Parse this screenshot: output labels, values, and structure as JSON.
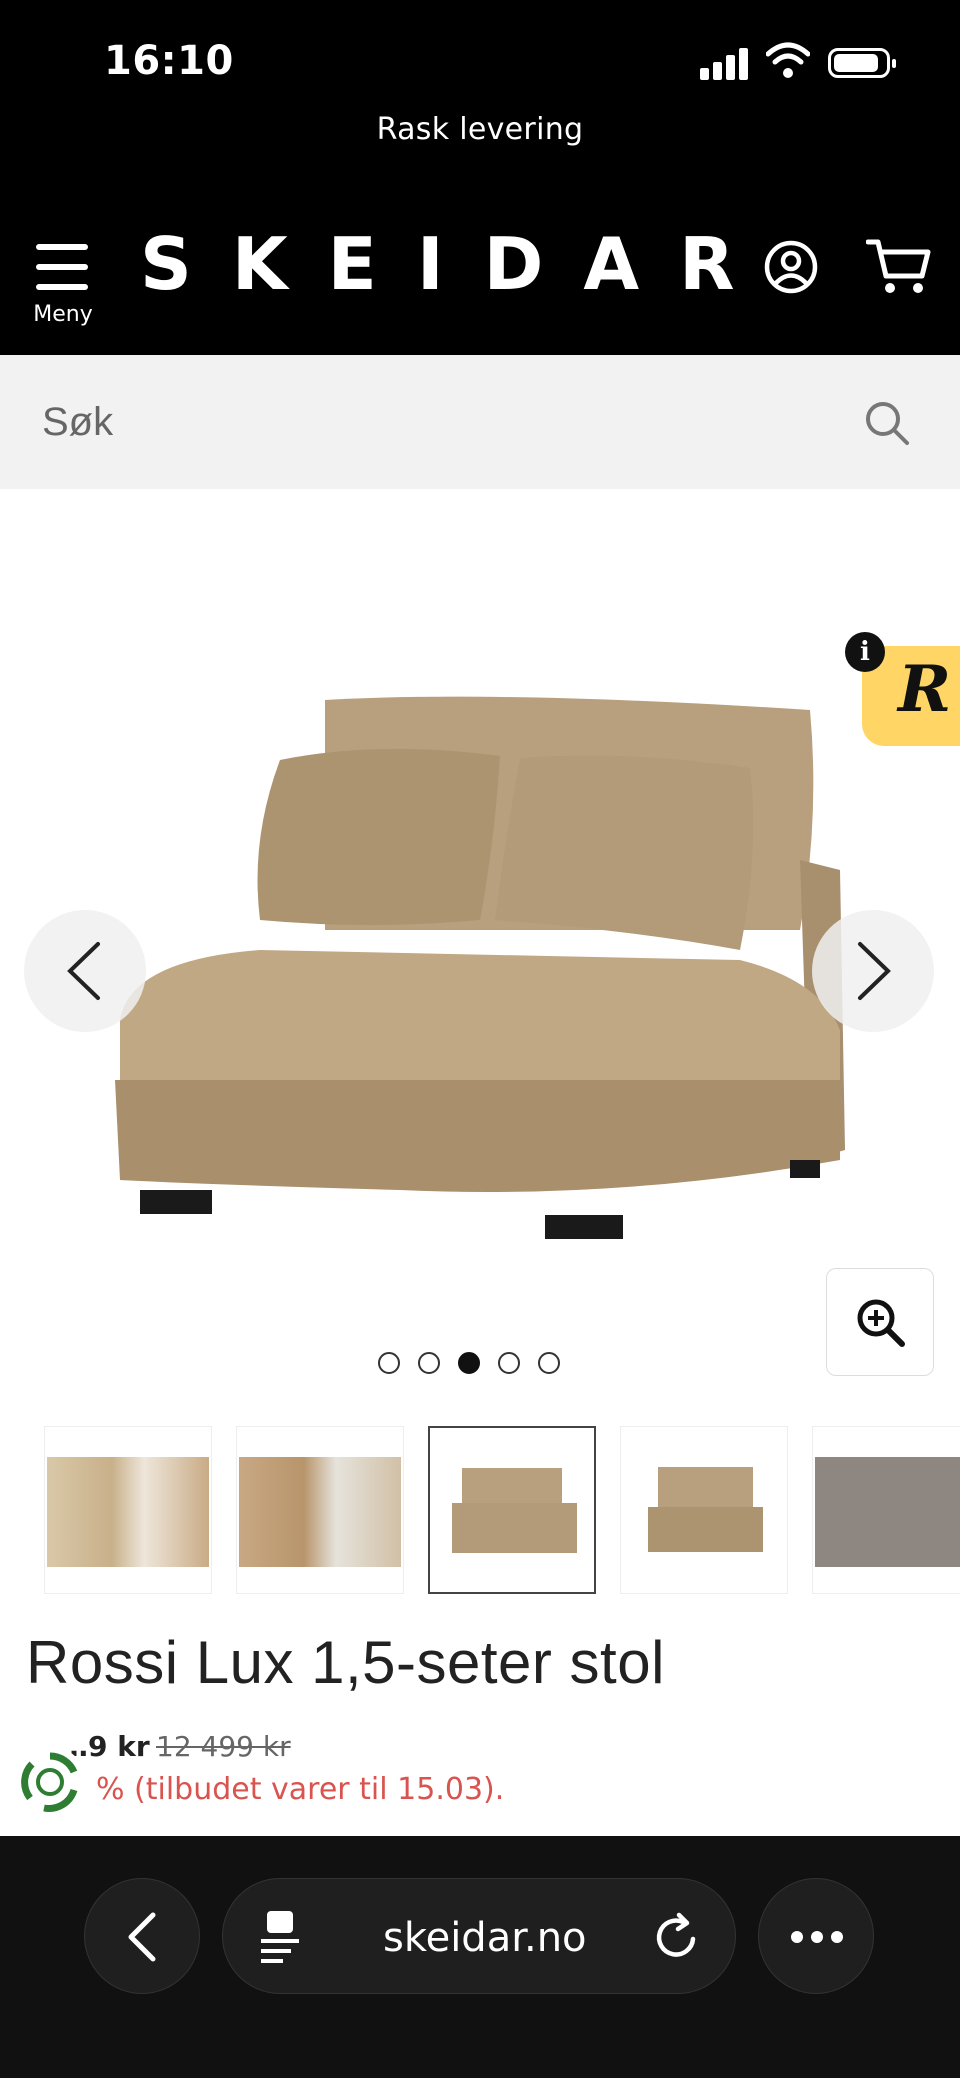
{
  "status_bar": {
    "time": "16:10"
  },
  "header": {
    "promo_text": "Rask levering",
    "menu_label": "Meny",
    "logo_text": "SKEIDAR"
  },
  "search": {
    "placeholder": "Søk"
  },
  "gallery": {
    "total_slides": 5,
    "active_slide": 3,
    "badge_letter": "R",
    "info_letter": "i"
  },
  "product": {
    "title": "Rossi Lux 1,5-seter stol",
    "price_partial": "…9 kr",
    "old_price": "12 499 kr",
    "offer_partial": "% (tilbudet varer til 15.03)."
  },
  "browser": {
    "url": "skeidar.no"
  },
  "colors": {
    "header_bg": "#000000",
    "sofa": "#b49a78",
    "sale_red": "#d9534f",
    "badge_yellow": "#ffd666"
  }
}
